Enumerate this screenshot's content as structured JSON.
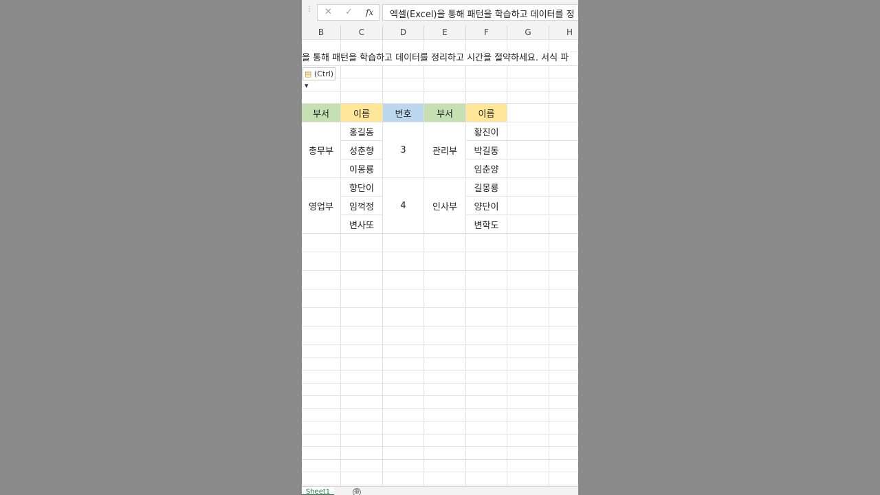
{
  "formula_bar": {
    "cancel_icon": "✕",
    "enter_icon": "✓",
    "function_icon": "fx",
    "formula_text": "엑셀(Excel)을 통해 패턴을 학습하고 데이터를 정"
  },
  "columns": [
    "B",
    "C",
    "D",
    "E",
    "F",
    "G",
    "H"
  ],
  "overflow_text": "을 통해 패턴을 학습하고 데이터를 정리하고 시간을 절약하세요. 서식 파",
  "paste_options": {
    "icon": "clipboard-icon",
    "label": "(Ctrl)",
    "arrow": "▾"
  },
  "table": {
    "headers": [
      "부서",
      "이름",
      "번호",
      "부서",
      "이름"
    ],
    "header_colors": {
      "green": "#c6e0b4",
      "yellow": "#ffe699",
      "blue": "#bdd7ee"
    },
    "groups": [
      {
        "dept_left": "총무부",
        "names_left": [
          "홍길동",
          "성춘향",
          "이몽룡"
        ],
        "number": "3",
        "dept_right": "관리부",
        "names_right": [
          "황진이",
          "박길동",
          "임춘양"
        ]
      },
      {
        "dept_left": "영업부",
        "names_left": [
          "향단이",
          "임꺽정",
          "변사또"
        ],
        "number": "4",
        "dept_right": "인사부",
        "names_right": [
          "길몽룡",
          "양단이",
          "변학도"
        ]
      }
    ]
  },
  "sheet_tabs": {
    "active": "Sheet1",
    "add_icon": "⊕"
  }
}
